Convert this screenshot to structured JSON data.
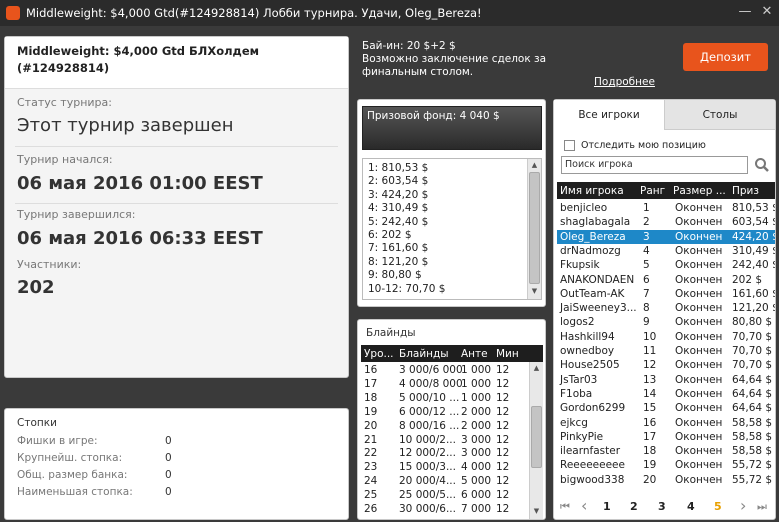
{
  "window": {
    "title": "Middleweight: $4,000 Gtd(#124928814) Лобби турнира. Удачи, Oleg_Bereza!",
    "minimize": "—",
    "close": "✕"
  },
  "info": {
    "tournament_name": "Middleweight: $4,000 Gtd БЛХолдем (#124928814)",
    "status_label": "Статус турнира:",
    "status_value": "Этот турнир завершен",
    "started_label": "Турнир начался:",
    "started_value": "06 мая 2016   01:00 EEST",
    "ended_label": "Турнир завершился:",
    "ended_value": "06 мая 2016   06:33 EEST",
    "players_label": "Участники:",
    "players_value": "202"
  },
  "stacks": {
    "title": "Стопки",
    "rows": [
      {
        "label": "Фишки в игре:",
        "value": "0"
      },
      {
        "label": "Крупнейш. стопка:",
        "value": "0"
      },
      {
        "label": "Общ. размер банка:",
        "value": "0"
      },
      {
        "label": "Наименьшая стопка:",
        "value": "0"
      }
    ]
  },
  "buyin": {
    "line1": "Бай-ин: 20 $+2 $",
    "line2": "Возможно заключение сделок за",
    "line3": "финальным столом.",
    "more_link": "Подробнее",
    "deposit_button": "Депозит"
  },
  "prize": {
    "header": "Призовой фонд: 4 040 $",
    "rows": [
      "1: 810,53 $",
      "2: 603,54 $",
      "3: 424,20 $",
      "4: 310,49 $",
      "5: 242,40 $",
      "6: 202 $",
      "7: 161,60 $",
      "8: 121,20 $",
      "9: 80,80 $",
      "10-12: 70,70 $"
    ]
  },
  "blinds": {
    "title": "Блайнды",
    "columns": [
      "Уро...",
      "Блайнды",
      "Анте",
      "Мин"
    ],
    "rows": [
      [
        "16",
        "3 000/6 000",
        "1 000",
        "12"
      ],
      [
        "17",
        "4 000/8 000",
        "1 000",
        "12"
      ],
      [
        "18",
        "5 000/10 ...",
        "1 000",
        "12"
      ],
      [
        "19",
        "6 000/12 ...",
        "2 000",
        "12"
      ],
      [
        "20",
        "8 000/16 ...",
        "2 000",
        "12"
      ],
      [
        "21",
        "10 000/2...",
        "3 000",
        "12"
      ],
      [
        "22",
        "12 000/2...",
        "3 000",
        "12"
      ],
      [
        "23",
        "15 000/3...",
        "4 000",
        "12"
      ],
      [
        "24",
        "20 000/4...",
        "5 000",
        "12"
      ],
      [
        "25",
        "25 000/5...",
        "6 000",
        "12"
      ],
      [
        "26",
        "30 000/6...",
        "7 000",
        "12"
      ]
    ]
  },
  "players": {
    "tabs": [
      "Все игроки",
      "Столы"
    ],
    "track_label": "Отследить мою позицию",
    "search_placeholder": "Поиск игрока",
    "columns": [
      "Имя игрока",
      "Ранг",
      "Размер ...",
      "Приз"
    ],
    "rows": [
      [
        "benjicleo",
        "1",
        "Окончен",
        "810,53 $"
      ],
      [
        "shaglabagala",
        "2",
        "Окончен",
        "603,54 $"
      ],
      [
        "Oleg_Bereza",
        "3",
        "Окончен",
        "424,20 $"
      ],
      [
        "drNadmozg",
        "4",
        "Окончен",
        "310,49 $"
      ],
      [
        "Fkupsik",
        "5",
        "Окончен",
        "242,40 $"
      ],
      [
        "ANAKONDAEN",
        "6",
        "Окончен",
        "202 $"
      ],
      [
        "OutTeam-AK",
        "7",
        "Окончен",
        "161,60 $"
      ],
      [
        "JaiSweeney3...",
        "8",
        "Окончен",
        "121,20 $"
      ],
      [
        "logos2",
        "9",
        "Окончен",
        "80,80 $"
      ],
      [
        "Hashkill94",
        "10",
        "Окончен",
        "70,70 $"
      ],
      [
        "ownedboy",
        "11",
        "Окончен",
        "70,70 $"
      ],
      [
        "House2505",
        "12",
        "Окончен",
        "70,70 $"
      ],
      [
        "JsTar03",
        "13",
        "Окончен",
        "64,64 $"
      ],
      [
        "F1oba",
        "14",
        "Окончен",
        "64,64 $"
      ],
      [
        "Gordon6299",
        "15",
        "Окончен",
        "64,64 $"
      ],
      [
        "ejkcg",
        "16",
        "Окончен",
        "58,58 $"
      ],
      [
        "PinkyPie",
        "17",
        "Окончен",
        "58,58 $"
      ],
      [
        "ilearnfaster",
        "18",
        "Окончен",
        "58,58 $"
      ],
      [
        "Reeeeeeeee",
        "19",
        "Окончен",
        "55,72 $"
      ],
      [
        "bigwood338",
        "20",
        "Окончен",
        "55,72 $"
      ]
    ],
    "selected_index": 2,
    "pagination": {
      "first": "⏮",
      "prev": "‹",
      "next": "›",
      "last": "⏭",
      "pages": [
        "1",
        "2",
        "3",
        "4",
        "5"
      ],
      "current": "1",
      "highlight_color": "#e8a000"
    }
  },
  "colors": {
    "accent": "#e8541c",
    "selection": "#1e88c8"
  }
}
